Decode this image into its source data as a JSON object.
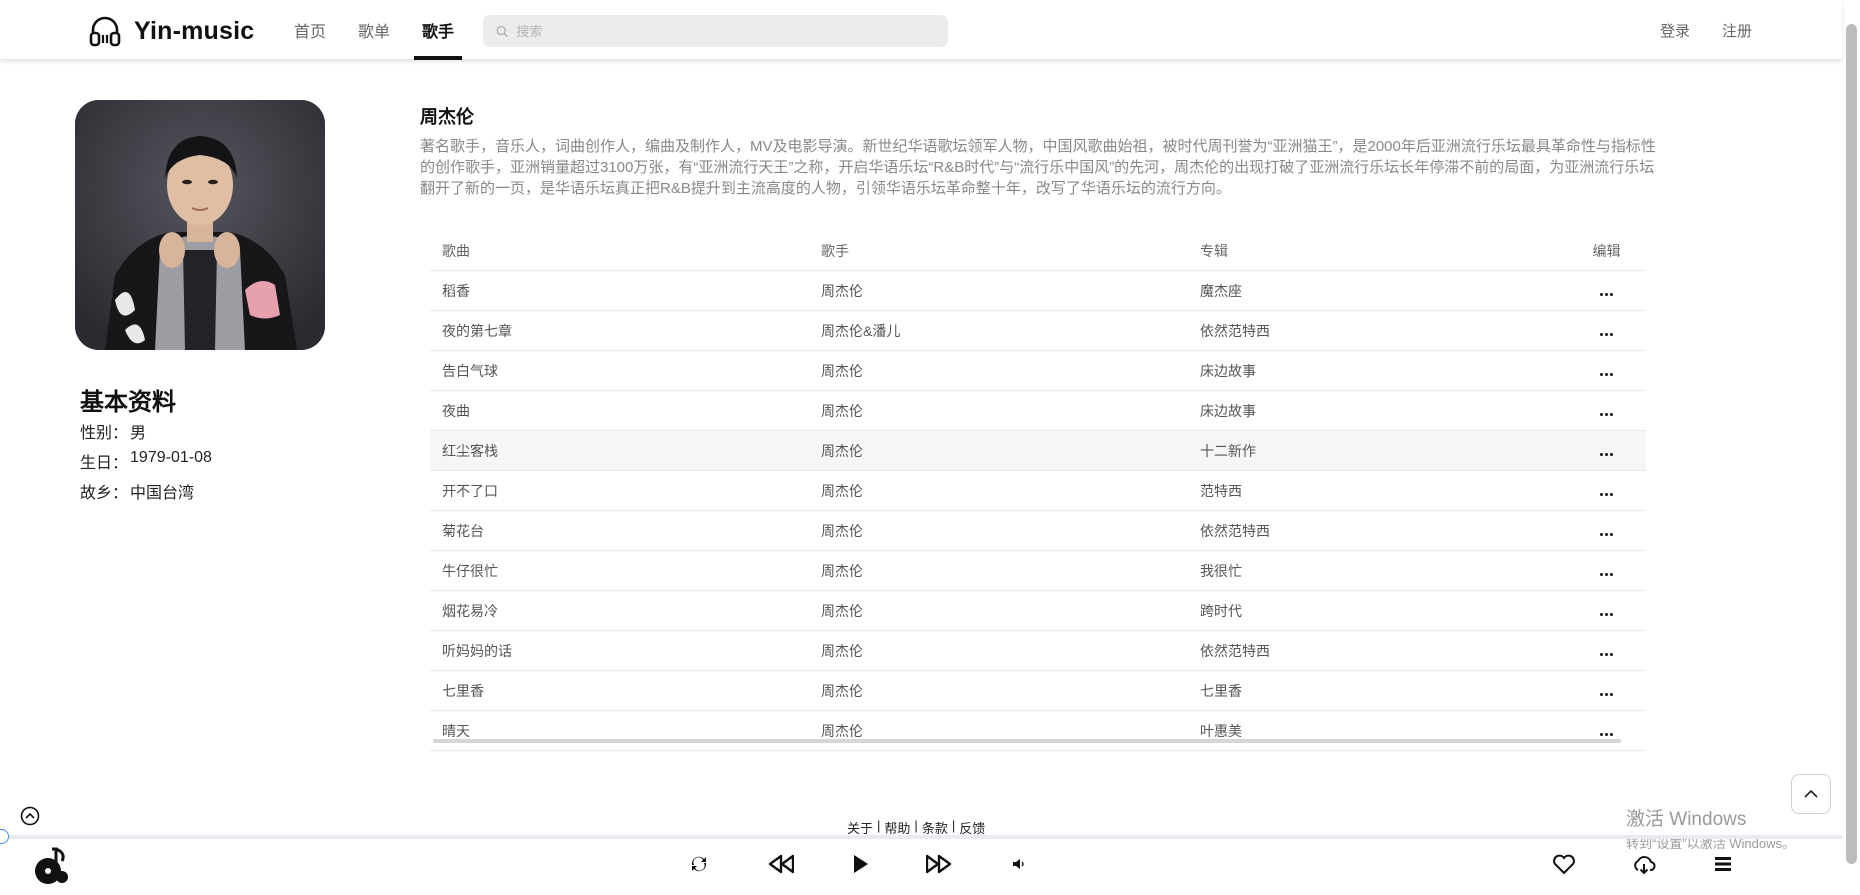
{
  "header": {
    "logo_text": "Yin-music",
    "nav": [
      "首页",
      "歌单",
      "歌手"
    ],
    "active_nav": 2,
    "search_placeholder": "搜索",
    "login": "登录",
    "register": "注册"
  },
  "profile": {
    "title": "基本资料",
    "gender_label": "性别：",
    "gender": "男",
    "birthday_label": "生日：",
    "birthday": "1979-01-08",
    "hometown_label": "故乡：",
    "hometown": "中国台湾"
  },
  "artist": {
    "name": "周杰伦",
    "description": "著名歌手，音乐人，词曲创作人，编曲及制作人，MV及电影导演。新世纪华语歌坛领军人物，中国风歌曲始祖，被时代周刊誉为“亚洲猫王”，是2000年后亚洲流行乐坛最具革命性与指标性的创作歌手，亚洲销量超过3100万张，有“亚洲流行天王”之称，开启华语乐坛“R&B时代”与“流行乐中国风”的先河，周杰伦的出现打破了亚洲流行乐坛长年停滞不前的局面，为亚洲流行乐坛翻开了新的一页，是华语乐坛真正把R&B提升到主流高度的人物，引领华语乐坛革命整十年，改写了华语乐坛的流行方向。"
  },
  "table": {
    "headers": {
      "song": "歌曲",
      "singer": "歌手",
      "album": "专辑",
      "edit": "编辑"
    },
    "rows": [
      {
        "song": "稻香",
        "singer": "周杰伦",
        "album": "魔杰座"
      },
      {
        "song": "夜的第七章",
        "singer": "周杰伦&潘儿",
        "album": "依然范特西"
      },
      {
        "song": "告白气球",
        "singer": "周杰伦",
        "album": "床边故事"
      },
      {
        "song": "夜曲",
        "singer": "周杰伦",
        "album": "床边故事"
      },
      {
        "song": "红尘客栈",
        "singer": "周杰伦",
        "album": "十二新作"
      },
      {
        "song": "开不了口",
        "singer": "周杰伦",
        "album": "范特西"
      },
      {
        "song": "菊花台",
        "singer": "周杰伦",
        "album": "依然范特西"
      },
      {
        "song": "牛仔很忙",
        "singer": "周杰伦",
        "album": "我很忙"
      },
      {
        "song": "烟花易冷",
        "singer": "周杰伦",
        "album": "跨时代"
      },
      {
        "song": "听妈妈的话",
        "singer": "周杰伦",
        "album": "依然范特西"
      },
      {
        "song": "七里香",
        "singer": "周杰伦",
        "album": "七里香"
      },
      {
        "song": "晴天",
        "singer": "周杰伦",
        "album": "叶惠美"
      }
    ],
    "hover_row": 4
  },
  "footer": {
    "about": "关于",
    "help": "帮助",
    "terms": "条款",
    "feedback": "反馈",
    "sep": "|"
  },
  "windows": {
    "line1": "激活 Windows",
    "line2": "转到“设置”以激活 Windows。"
  },
  "player": {
    "progress": 0
  }
}
